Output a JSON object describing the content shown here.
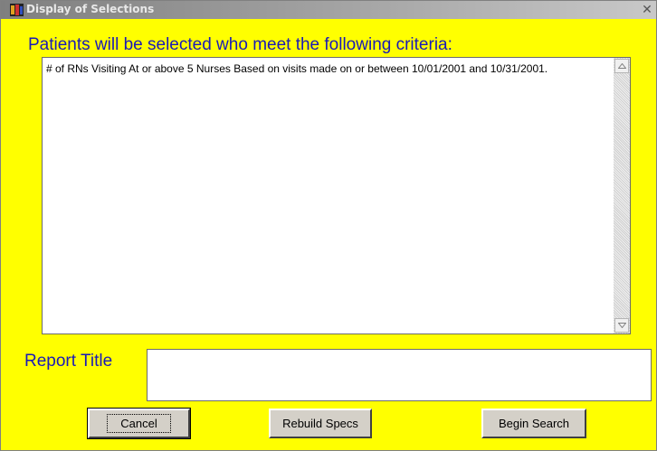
{
  "window": {
    "title": "Display of Selections",
    "close_glyph": "✕"
  },
  "main": {
    "heading": "Patients will be selected who meet the following criteria:",
    "criteria_text": "# of RNs Visiting At or above 5 Nurses  Based on visits made on or between 10/01/2001 and 10/31/2001."
  },
  "report": {
    "label": "Report Title",
    "value": ""
  },
  "buttons": {
    "cancel": "Cancel",
    "rebuild": "Rebuild Specs",
    "begin": "Begin Search"
  },
  "colors": {
    "background": "#ffff00",
    "heading_text": "#1a1ab8"
  },
  "icons": {
    "app": "app-icon",
    "close": "close-icon",
    "scroll_up": "scroll-up-arrow-icon",
    "scroll_down": "scroll-down-arrow-icon"
  }
}
